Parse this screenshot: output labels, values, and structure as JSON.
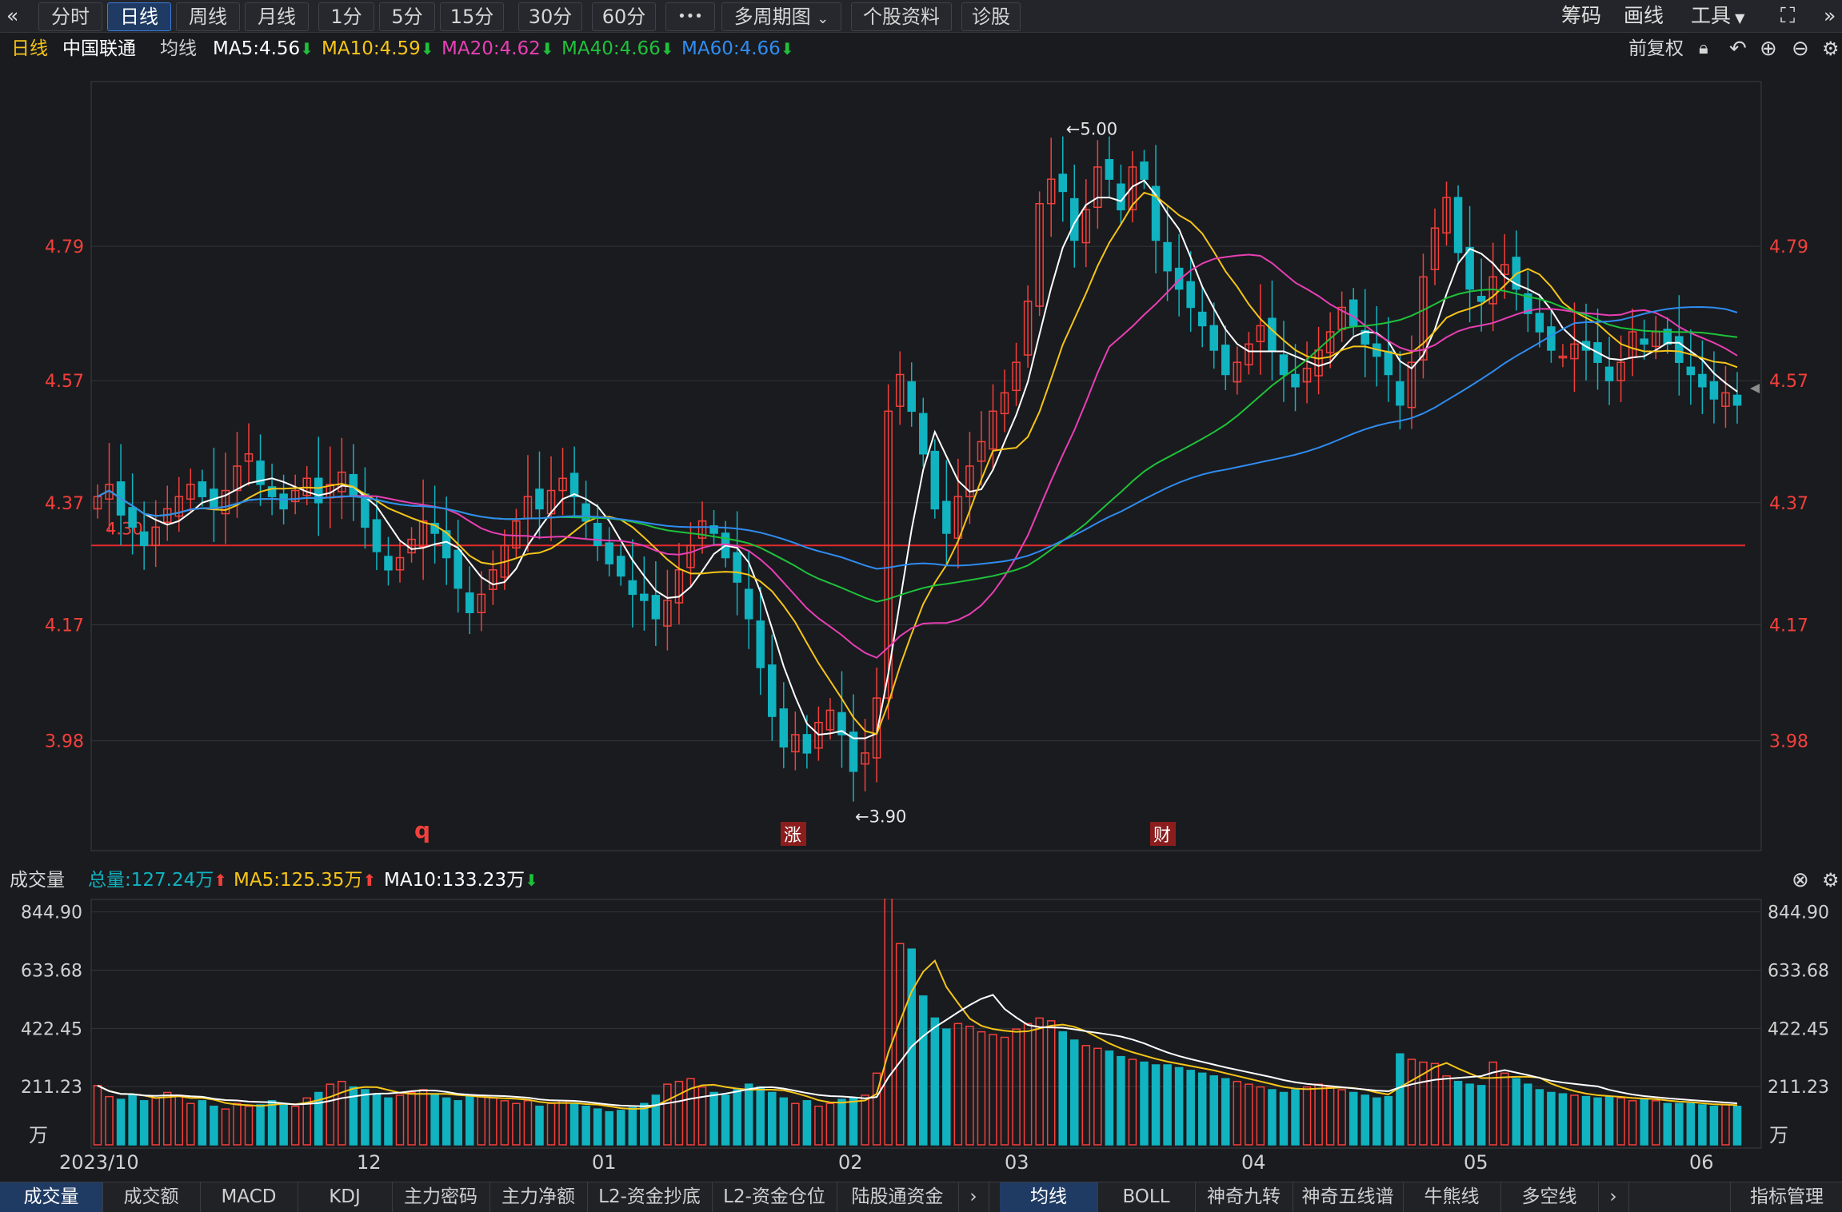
{
  "toolbar": {
    "collapse_icon": "double-chevron-left-icon",
    "periods": [
      "分时",
      "日线",
      "周线",
      "月线",
      "1分",
      "5分",
      "15分",
      "30分",
      "60分"
    ],
    "active_period": "日线",
    "more_label": "•••",
    "multi_period": "多周期图",
    "stock_info": "个股资料",
    "diagnose": "诊股",
    "right_items": [
      "筹码",
      "画线",
      "工具"
    ],
    "fullscreen_icon": "fullscreen-icon",
    "collapse_right_icon": "double-chevron-right-icon"
  },
  "infobar": {
    "period": "日线",
    "stock_name": "中国联通",
    "ma_title": "均线",
    "ma5": "MA5:4.56",
    "ma10": "MA10:4.59",
    "ma20": "MA20:4.62",
    "ma40": "MA40:4.66",
    "ma60": "MA60:4.66",
    "adjust": "前复权"
  },
  "colors": {
    "up": "#f2403b",
    "down": "#11b3c0",
    "ma5": "#ffffff",
    "ma10": "#f5c518",
    "ma20": "#e83fb4",
    "ma40": "#1ec23a",
    "ma60": "#2f8cf0",
    "ref_line": "#e52b2b"
  },
  "price_axis": {
    "ticks": [
      "4.79",
      "4.57",
      "4.37",
      "4.17",
      "3.98"
    ],
    "tick_values": [
      4.79,
      4.57,
      4.37,
      4.17,
      3.98
    ],
    "min": 3.8,
    "max": 5.06
  },
  "annotations": {
    "high": "←5.00",
    "low": "←3.90",
    "ref_label": "4.30",
    "ref_value": 4.3,
    "marker_q": "q",
    "marker_zhang": "涨",
    "marker_cai": "财"
  },
  "volume": {
    "title": "成交量",
    "total": "总量:127.24万",
    "ma5": "MA5:125.35万",
    "ma10": "MA10:133.23万",
    "ticks": [
      "844.90",
      "633.68",
      "422.45",
      "211.23"
    ],
    "tick_values": [
      844.9,
      633.68,
      422.45,
      211.23
    ],
    "unit": "万",
    "max": 870
  },
  "dates": [
    "2023/10",
    "12",
    "01",
    "02",
    "03",
    "04",
    "05",
    "06"
  ],
  "bottom_tabs_left": [
    "成交量",
    "成交额",
    "MACD",
    "KDJ",
    "主力密码",
    "主力净额",
    "L2-资金抄底",
    "L2-资金仓位",
    "陆股通资金"
  ],
  "bottom_tabs_right": [
    "均线",
    "BOLL",
    "神奇九转",
    "神奇五线谱",
    "牛熊线",
    "多空线"
  ],
  "indicator_manage": "指标管理",
  "chart_data": {
    "type": "candlestick",
    "price": [
      4.38,
      4.4,
      4.35,
      4.33,
      4.3,
      4.33,
      4.36,
      4.38,
      4.4,
      4.38,
      4.36,
      4.39,
      4.43,
      4.45,
      4.4,
      4.38,
      4.36,
      4.39,
      4.41,
      4.37,
      4.4,
      4.42,
      4.38,
      4.33,
      4.29,
      4.26,
      4.28,
      4.31,
      4.34,
      4.32,
      4.28,
      4.23,
      4.19,
      4.22,
      4.26,
      4.3,
      4.34,
      4.38,
      4.36,
      4.39,
      4.41,
      4.38,
      4.34,
      4.3,
      4.27,
      4.25,
      4.22,
      4.21,
      4.18,
      4.21,
      4.26,
      4.3,
      4.34,
      4.32,
      4.28,
      4.24,
      4.18,
      4.1,
      4.02,
      3.97,
      3.99,
      3.96,
      4.01,
      4.03,
      3.99,
      3.93,
      3.96,
      4.05,
      4.52,
      4.58,
      4.52,
      4.45,
      4.36,
      4.32,
      4.38,
      4.43,
      4.47,
      4.52,
      4.55,
      4.6,
      4.7,
      4.86,
      4.9,
      4.88,
      4.8,
      4.85,
      4.92,
      4.9,
      4.85,
      4.92,
      4.9,
      4.8,
      4.75,
      4.72,
      4.69,
      4.66,
      4.62,
      4.58,
      4.6,
      4.63,
      4.66,
      4.62,
      4.58,
      4.56,
      4.59,
      4.62,
      4.65,
      4.69,
      4.66,
      4.63,
      4.61,
      4.58,
      4.53,
      4.6,
      4.74,
      4.82,
      4.87,
      4.78,
      4.72,
      4.7,
      4.74,
      4.76,
      4.72,
      4.68,
      4.65,
      4.62,
      4.61,
      4.63,
      4.62,
      4.6,
      4.57,
      4.6,
      4.65,
      4.63,
      4.65,
      4.63,
      4.6,
      4.58,
      4.56,
      4.54,
      4.55,
      4.53
    ],
    "volume": [
      215,
      175,
      165,
      180,
      160,
      170,
      190,
      180,
      150,
      160,
      140,
      130,
      150,
      140,
      145,
      160,
      150,
      140,
      170,
      190,
      220,
      230,
      210,
      200,
      185,
      170,
      180,
      190,
      200,
      185,
      170,
      160,
      175,
      180,
      170,
      160,
      150,
      160,
      140,
      150,
      160,
      150,
      140,
      130,
      120,
      125,
      135,
      150,
      180,
      220,
      230,
      240,
      210,
      190,
      180,
      200,
      220,
      210,
      190,
      170,
      150,
      160,
      140,
      150,
      165,
      170,
      180,
      260,
      900,
      730,
      710,
      540,
      460,
      420,
      440,
      430,
      410,
      400,
      390,
      420,
      440,
      460,
      450,
      410,
      380,
      360,
      350,
      340,
      320,
      310,
      300,
      290,
      290,
      280,
      270,
      260,
      250,
      240,
      230,
      220,
      210,
      200,
      190,
      200,
      210,
      220,
      210,
      200,
      190,
      180,
      170,
      175,
      330,
      310,
      300,
      295,
      250,
      230,
      220,
      215,
      300,
      260,
      240,
      220,
      200,
      190,
      185,
      180,
      175,
      170,
      175,
      170,
      160,
      165,
      160,
      150,
      150,
      150,
      145,
      140,
      145,
      140
    ],
    "ylim": [
      3.8,
      5.06
    ]
  }
}
